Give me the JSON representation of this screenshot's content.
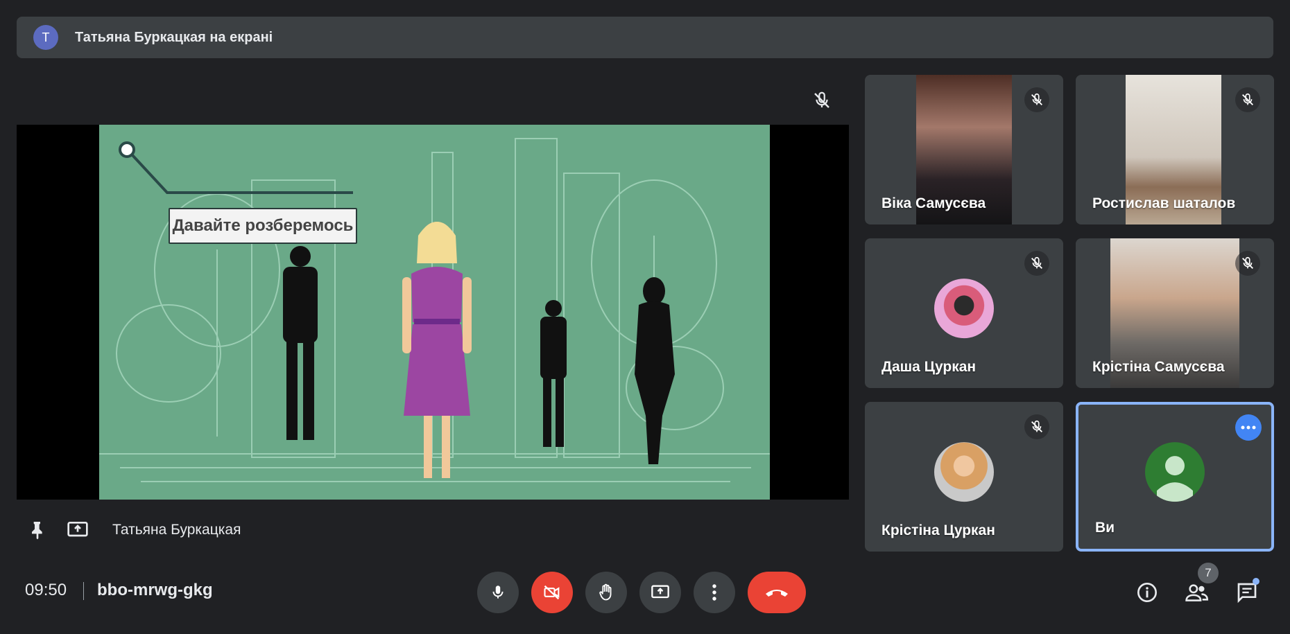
{
  "banner": {
    "avatar_letter": "T",
    "text": "Татьяна Буркацкая на екрані"
  },
  "presentation": {
    "slide_caption": "Давайте розберемось",
    "presenter_name": "Татьяна Буркацкая"
  },
  "participants": [
    {
      "name": "Віка Самусєва",
      "muted": true
    },
    {
      "name": "Ростислав шаталов",
      "muted": true
    },
    {
      "name": "Даша Цуркан",
      "muted": true
    },
    {
      "name": "Крістіна Самусєва",
      "muted": true
    },
    {
      "name": "Крістіна Цуркан",
      "muted": true
    },
    {
      "name": "Ви",
      "muted": false,
      "active": true
    }
  ],
  "meeting": {
    "time": "09:50",
    "code": "bbo-mrwg-gkg"
  },
  "controls": [
    "mic-icon",
    "camera-off-icon",
    "raise-hand-icon",
    "present-icon",
    "more-vert-icon",
    "hang-up-icon"
  ],
  "right_panel": {
    "participant_count": "7"
  },
  "colors": {
    "background": "#202124",
    "tile": "#3c4043",
    "accent": "#8ab4f8",
    "danger": "#ea4335",
    "slide_bg": "#6aa988"
  }
}
